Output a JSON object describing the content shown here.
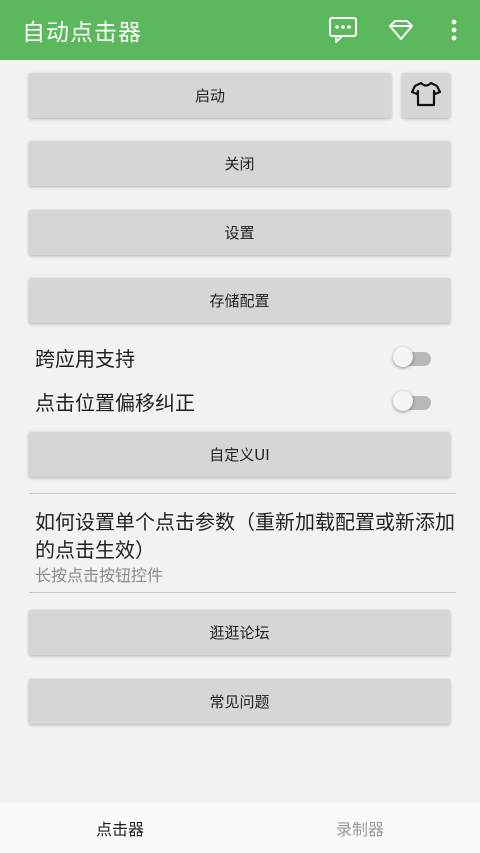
{
  "app": {
    "title": "自动点击器",
    "accent_color": "#5cb85c",
    "actions": [
      {
        "icon": "chat-icon"
      },
      {
        "icon": "diamond-icon"
      },
      {
        "icon": "more-vert-icon"
      }
    ]
  },
  "buttons": {
    "start": "启动",
    "shirt_icon": "shirt-icon",
    "close": "关闭",
    "settings": "设置",
    "save_config": "存储配置",
    "custom_ui": "自定义UI",
    "forum": "逛逛论坛",
    "faq": "常见问题"
  },
  "switches": {
    "cross_app": {
      "label": "跨应用支持",
      "checked": false
    },
    "offset_fix": {
      "label": "点击位置偏移纠正",
      "checked": false
    }
  },
  "help": {
    "title": "如何设置单个点击参数（重新加载配置或新添加的点击生效）",
    "summary": "长按点击按钮控件"
  },
  "bottom_nav": {
    "tabs": [
      {
        "label": "点击器",
        "active": true
      },
      {
        "label": "录制器",
        "active": false
      }
    ]
  }
}
